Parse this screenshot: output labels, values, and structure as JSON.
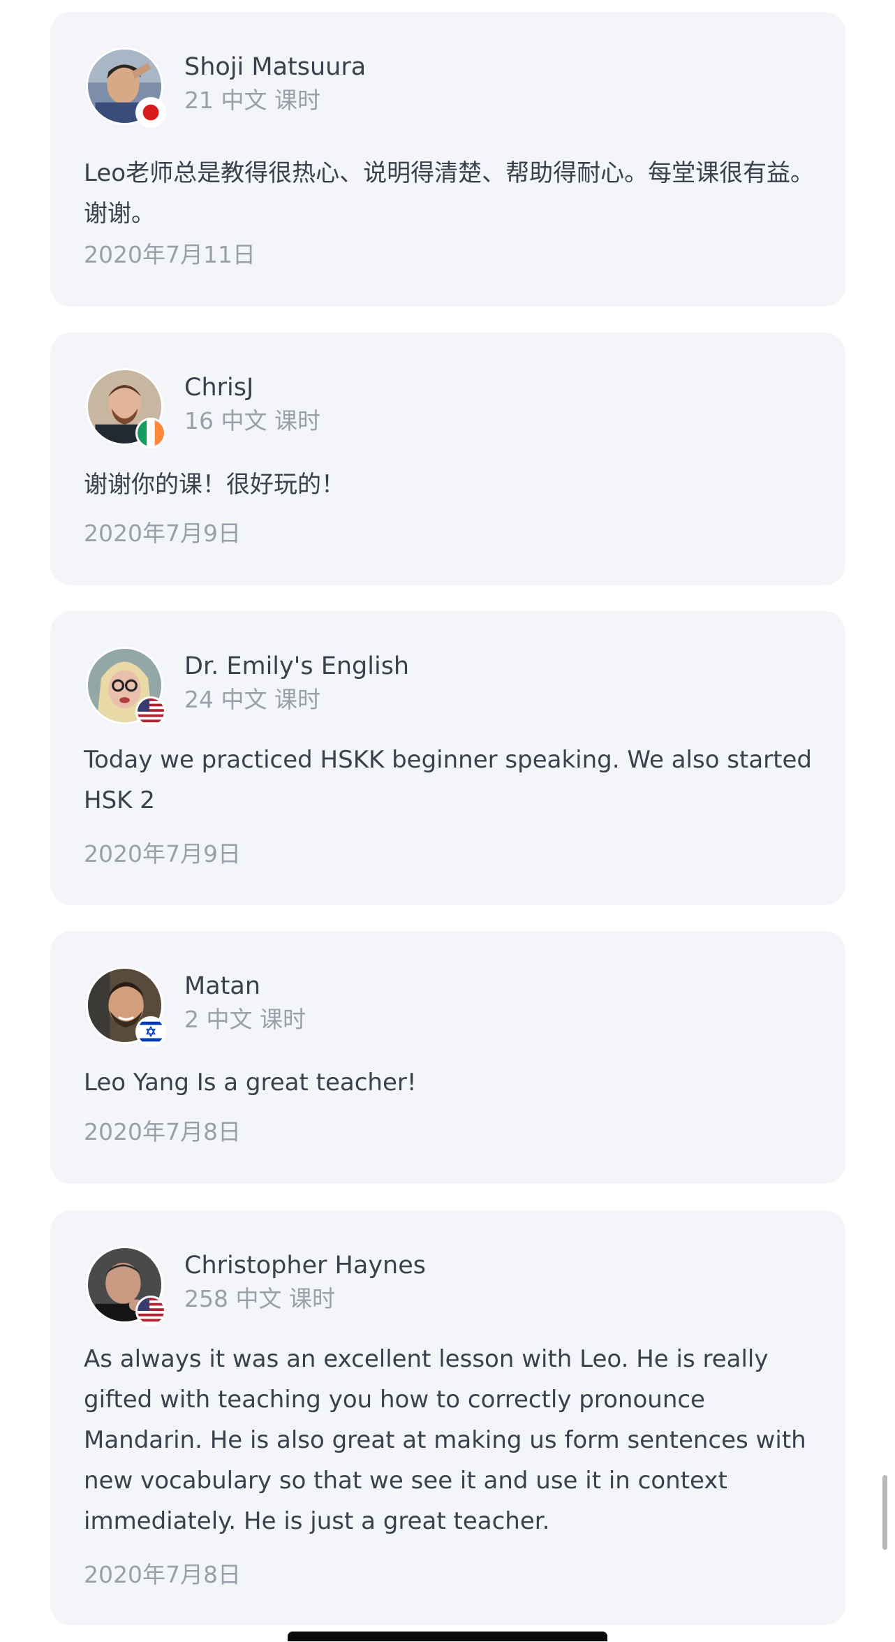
{
  "reviews": [
    {
      "name": "Shoji Matsuura",
      "lessons": "21 中文 课时",
      "comment": "Leo老师总是教得很热心、说明得清楚、帮助得耐心。每堂课很有益。谢谢。",
      "date": "2020年7月11日",
      "flag": "japan-flag-icon"
    },
    {
      "name": "ChrisJ",
      "lessons": "16 中文 课时",
      "comment": "谢谢你的课！很好玩的！",
      "date": "2020年7月9日",
      "flag": "ireland-flag-icon"
    },
    {
      "name": "Dr. Emily's English",
      "lessons": "24 中文 课时",
      "comment": "Today we practiced HSKK beginner speaking. We also started HSK 2",
      "date": "2020年7月9日",
      "flag": "usa-flag-icon"
    },
    {
      "name": "Matan",
      "lessons": "2 中文 课时",
      "comment": "Leo Yang Is a great teacher!",
      "date": "2020年7月8日",
      "flag": "israel-flag-icon"
    },
    {
      "name": "Christopher Haynes",
      "lessons": "258 中文 课时",
      "comment": "As always it was an excellent lesson with Leo. He is really gifted with teaching you how to correctly pronounce Mandarin. He is also great at making us form sentences with new vocabulary so that we see it and use it in context immediately. He is just a great teacher.",
      "date": "2020年7月8日",
      "flag": "usa-flag-icon"
    }
  ],
  "colors": {
    "card_background": "#f4f5f9",
    "primary_text": "#3a414c",
    "secondary_text": "#9aa0a9"
  }
}
